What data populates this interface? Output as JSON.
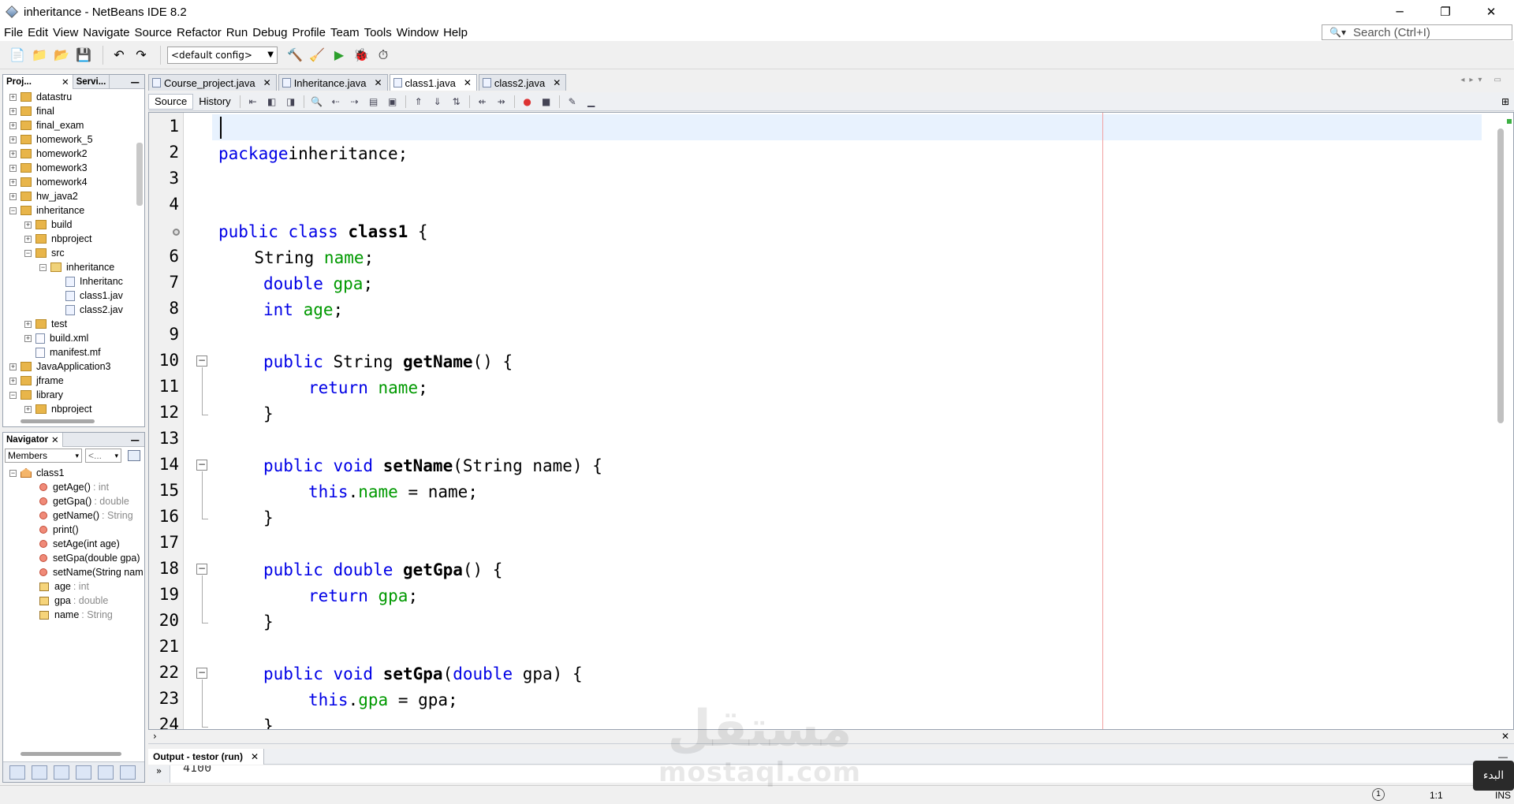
{
  "window": {
    "title": "inheritance - NetBeans IDE 8.2",
    "minimize": "─",
    "restore": "❐",
    "close": "✕"
  },
  "menu": [
    "File",
    "Edit",
    "View",
    "Navigate",
    "Source",
    "Refactor",
    "Run",
    "Debug",
    "Profile",
    "Team",
    "Tools",
    "Window",
    "Help"
  ],
  "search": {
    "placeholder": "Search (Ctrl+I)"
  },
  "toolbar": {
    "config": "<default config>"
  },
  "projects_panel": {
    "tabs": [
      "Proj...",
      "Servi..."
    ],
    "tree": [
      {
        "label": "datastru",
        "depth": 0,
        "type": "project",
        "exp": "+"
      },
      {
        "label": "final",
        "depth": 0,
        "type": "project",
        "exp": "+"
      },
      {
        "label": "final_exam",
        "depth": 0,
        "type": "project",
        "exp": "+"
      },
      {
        "label": "homework_5",
        "depth": 0,
        "type": "project",
        "exp": "+"
      },
      {
        "label": "homework2",
        "depth": 0,
        "type": "project",
        "exp": "+"
      },
      {
        "label": "homework3",
        "depth": 0,
        "type": "project",
        "exp": "+"
      },
      {
        "label": "homework4",
        "depth": 0,
        "type": "project",
        "exp": "+"
      },
      {
        "label": "hw_java2",
        "depth": 0,
        "type": "project",
        "exp": "+"
      },
      {
        "label": "inheritance",
        "depth": 0,
        "type": "project",
        "exp": "−"
      },
      {
        "label": "build",
        "depth": 1,
        "type": "folder",
        "exp": "+"
      },
      {
        "label": "nbproject",
        "depth": 1,
        "type": "folder",
        "exp": "+"
      },
      {
        "label": "src",
        "depth": 1,
        "type": "folder",
        "exp": "−"
      },
      {
        "label": "inheritance",
        "depth": 2,
        "type": "package",
        "exp": "−"
      },
      {
        "label": "Inheritanc",
        "depth": 3,
        "type": "java",
        "exp": ""
      },
      {
        "label": "class1.jav",
        "depth": 3,
        "type": "java",
        "exp": ""
      },
      {
        "label": "class2.jav",
        "depth": 3,
        "type": "java",
        "exp": ""
      },
      {
        "label": "test",
        "depth": 1,
        "type": "folder",
        "exp": "+"
      },
      {
        "label": "build.xml",
        "depth": 1,
        "type": "file",
        "exp": "+"
      },
      {
        "label": "manifest.mf",
        "depth": 1,
        "type": "file",
        "exp": ""
      },
      {
        "label": "JavaApplication3",
        "depth": 0,
        "type": "project",
        "exp": "+"
      },
      {
        "label": "jframe",
        "depth": 0,
        "type": "project",
        "exp": "+"
      },
      {
        "label": "library",
        "depth": 0,
        "type": "project",
        "exp": "−"
      },
      {
        "label": "nbproject",
        "depth": 1,
        "type": "folder",
        "exp": "+"
      }
    ]
  },
  "navigator": {
    "title": "Navigator",
    "filter": "Members",
    "filter2": "<...",
    "class": "class1",
    "members": [
      {
        "name": "getAge()",
        "type": ": int",
        "kind": "method"
      },
      {
        "name": "getGpa()",
        "type": ": double",
        "kind": "method"
      },
      {
        "name": "getName()",
        "type": ": String",
        "kind": "method"
      },
      {
        "name": "print()",
        "type": "",
        "kind": "method"
      },
      {
        "name": "setAge(int age)",
        "type": "",
        "kind": "method"
      },
      {
        "name": "setGpa(double gpa)",
        "type": "",
        "kind": "method"
      },
      {
        "name": "setName(String nam",
        "type": "",
        "kind": "method"
      },
      {
        "name": "age",
        "type": ": int",
        "kind": "field"
      },
      {
        "name": "gpa",
        "type": ": double",
        "kind": "field"
      },
      {
        "name": "name",
        "type": ": String",
        "kind": "field"
      }
    ]
  },
  "editor": {
    "tabs": [
      {
        "label": "Course_project.java",
        "active": false
      },
      {
        "label": "Inheritance.java",
        "active": false
      },
      {
        "label": "class1.java",
        "active": true
      },
      {
        "label": "class2.java",
        "active": false
      }
    ],
    "modes": [
      "Source",
      "History"
    ],
    "line_numbers": [
      "1",
      "2",
      "3",
      "4",
      "",
      "6",
      "7",
      "8",
      "9",
      "10",
      "11",
      "12",
      "13",
      "14",
      "15",
      "16",
      "17",
      "18",
      "19",
      "20",
      "21",
      "22",
      "23",
      "24"
    ],
    "lines": [
      [],
      [
        [
          "kw",
          "package"
        ],
        [
          "",
          "inheritance;"
        ]
      ],
      [],
      [],
      [
        [
          "kw",
          "public class "
        ],
        [
          "b",
          "class1"
        ],
        [
          "",
          " {"
        ]
      ],
      [
        [
          "",
          " String "
        ],
        [
          "fd",
          "name"
        ],
        [
          "",
          ";"
        ]
      ],
      [
        [
          "kw",
          "double "
        ],
        [
          "fd",
          "gpa"
        ],
        [
          "",
          ";"
        ]
      ],
      [
        [
          "kw",
          "int "
        ],
        [
          "fd",
          "age"
        ],
        [
          "",
          ";"
        ]
      ],
      [],
      [
        [
          "kw",
          "public "
        ],
        [
          "",
          "String "
        ],
        [
          "b",
          "getName"
        ],
        [
          "",
          "() {"
        ]
      ],
      [
        [
          "kw",
          "return "
        ],
        [
          "fd",
          "name"
        ],
        [
          "",
          ";"
        ]
      ],
      [
        [
          "",
          "}"
        ]
      ],
      [],
      [
        [
          "kw",
          "public void "
        ],
        [
          "b",
          "setName"
        ],
        [
          "",
          "(String name) {"
        ]
      ],
      [
        [
          "kw",
          "this"
        ],
        [
          "",
          "."
        ],
        [
          "fd",
          "name"
        ],
        [
          "",
          " = name;"
        ]
      ],
      [
        [
          "",
          "}"
        ]
      ],
      [],
      [
        [
          "kw",
          "public double "
        ],
        [
          "b",
          "getGpa"
        ],
        [
          "",
          "() {"
        ]
      ],
      [
        [
          "kw",
          "return "
        ],
        [
          "fd",
          "gpa"
        ],
        [
          "",
          ";"
        ]
      ],
      [
        [
          "",
          "}"
        ]
      ],
      [],
      [
        [
          "kw",
          "public void "
        ],
        [
          "b",
          "setGpa"
        ],
        [
          "",
          "("
        ],
        [
          "kw",
          "double"
        ],
        [
          "",
          " gpa) {"
        ]
      ],
      [
        [
          "kw",
          "this"
        ],
        [
          "",
          "."
        ],
        [
          "fd",
          "gpa"
        ],
        [
          "",
          " = gpa;"
        ]
      ],
      [
        [
          "",
          "}"
        ]
      ]
    ]
  },
  "output": {
    "tab": "Output - testor (run)",
    "text": "4100"
  },
  "status": {
    "position": "1:1",
    "mode": "INS"
  },
  "watermark": {
    "arabic": "مستقل",
    "latin": "mostaql.com"
  },
  "tooltip": "البدء"
}
